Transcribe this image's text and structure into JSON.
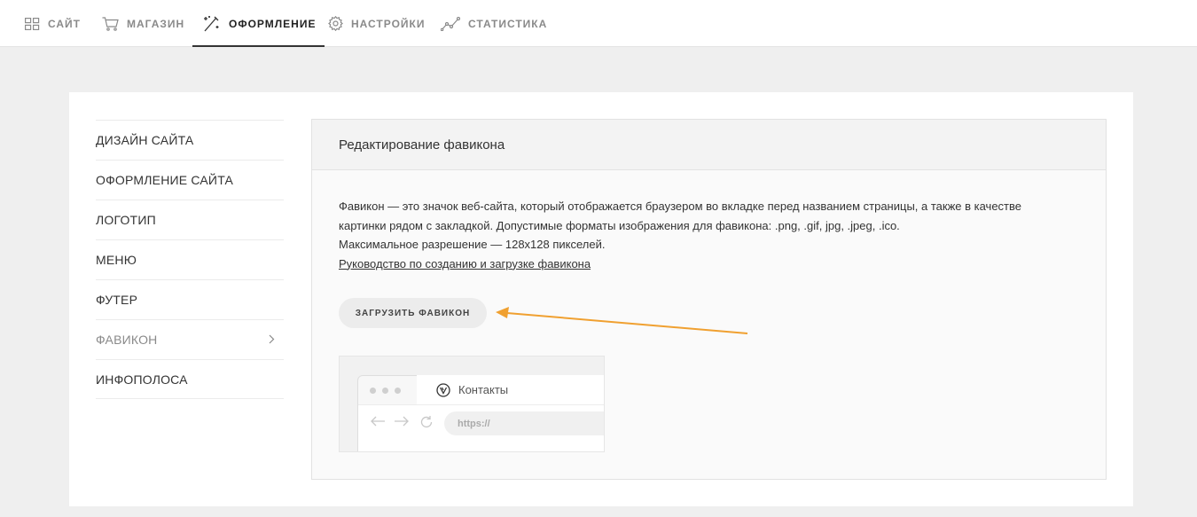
{
  "nav": [
    {
      "label": "САЙТ",
      "icon": "grid-icon"
    },
    {
      "label": "МАГАЗИН",
      "icon": "cart-icon"
    },
    {
      "label": "ОФОРМЛЕНИЕ",
      "icon": "magic-wand-icon",
      "active": true
    },
    {
      "label": "НАСТРОЙКИ",
      "icon": "gear-icon"
    },
    {
      "label": "СТАТИСТИКА",
      "icon": "chart-icon"
    }
  ],
  "sidebar": {
    "items": [
      {
        "label": "ДИЗАЙН САЙТА"
      },
      {
        "label": "ОФОРМЛЕНИЕ САЙТА"
      },
      {
        "label": "ЛОГОТИП"
      },
      {
        "label": "МЕНЮ"
      },
      {
        "label": "ФУТЕР"
      },
      {
        "label": "ФАВИКОН",
        "active": true
      },
      {
        "label": "ИНФОПОЛОСА"
      }
    ]
  },
  "panel": {
    "title": "Редактирование фавикона",
    "description_line1": "Фавикон — это значок веб-сайта, который отображается браузером во вкладке перед названием страницы, а также в качестве",
    "description_line2": "картинки рядом с закладкой. Допустимые форматы изображения для фавикона: .png, .gif, jpg, .jpeg, .ico.",
    "description_line3": "Максимальное разрешение — 128x128 пикселей.",
    "guide_link": "Руководство по созданию и загрузке фавикона",
    "upload_button": "ЗАГРУЗИТЬ ФАВИКОН"
  },
  "preview": {
    "tab_title": "Контакты",
    "url": "https://"
  },
  "colors": {
    "annotation_arrow": "#f0a030",
    "active_text": "#222222",
    "muted_text": "#8a8a8a"
  }
}
